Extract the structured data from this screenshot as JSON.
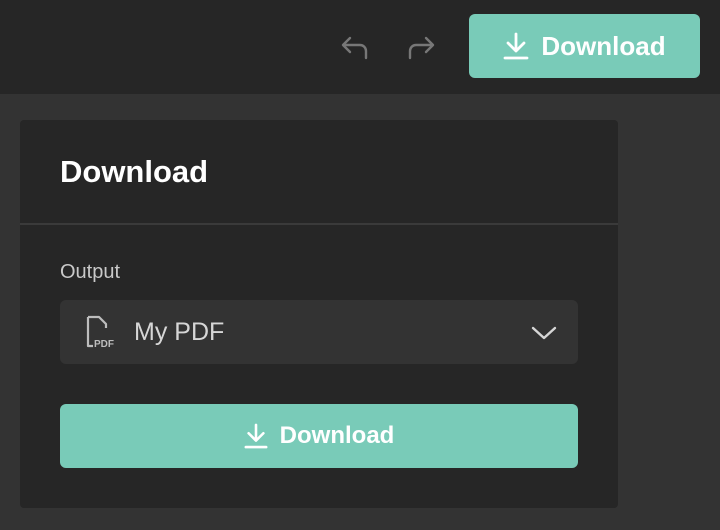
{
  "toolbar": {
    "download_label": "Download"
  },
  "icons": {
    "undo": "undo-icon",
    "redo": "redo-icon",
    "download": "download-icon",
    "pdf": "pdf-file-icon",
    "chevron": "chevron-down-icon"
  },
  "panel": {
    "title": "Download",
    "output_label": "Output",
    "output_value": "My PDF",
    "download_label": "Download"
  },
  "colors": {
    "accent": "#79CBB8",
    "topbar_bg": "#262626",
    "panel_bg": "#262626",
    "page_bg": "#333333"
  }
}
